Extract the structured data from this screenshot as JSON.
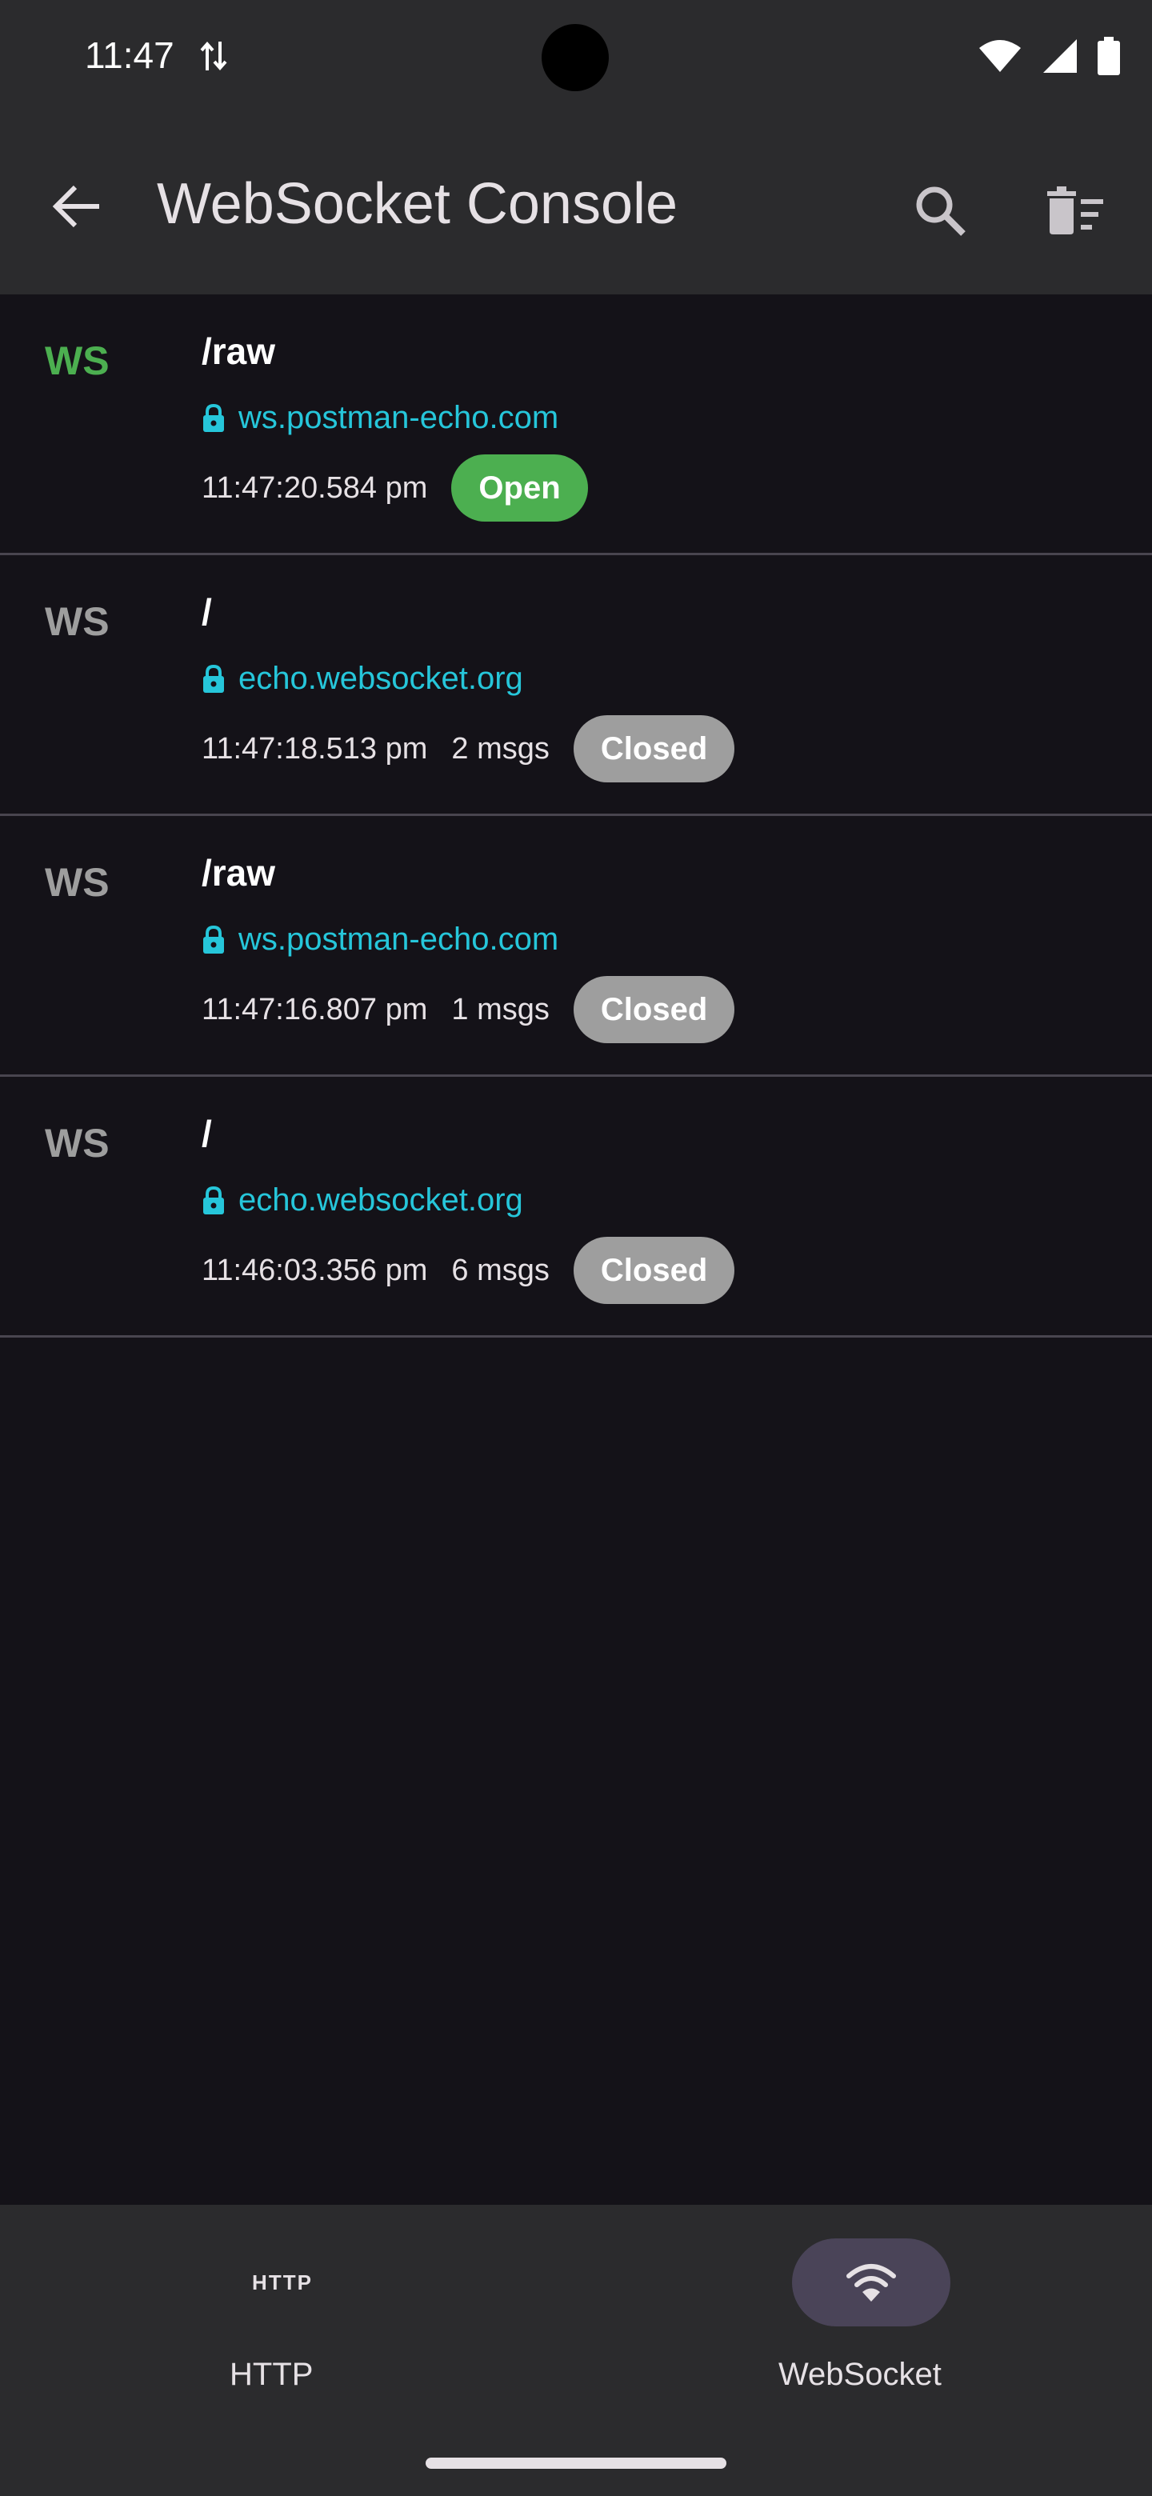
{
  "status_bar": {
    "time": "11:47"
  },
  "app_bar": {
    "title": "WebSocket Console"
  },
  "connections": [
    {
      "tag": "WS",
      "path": "/raw",
      "host": "ws.postman-echo.com",
      "time": "11:47:20.584 pm",
      "msgs": "",
      "status": "Open",
      "state": "open"
    },
    {
      "tag": "WS",
      "path": "/",
      "host": "echo.websocket.org",
      "time": "11:47:18.513 pm",
      "msgs": "2 msgs",
      "status": "Closed",
      "state": "closed"
    },
    {
      "tag": "WS",
      "path": "/raw",
      "host": "ws.postman-echo.com",
      "time": "11:47:16.807 pm",
      "msgs": "1 msgs",
      "status": "Closed",
      "state": "closed"
    },
    {
      "tag": "WS",
      "path": "/",
      "host": "echo.websocket.org",
      "time": "11:46:03.356 pm",
      "msgs": "6 msgs",
      "status": "Closed",
      "state": "closed"
    }
  ],
  "bottom_nav": {
    "http_glyph": "HTTP",
    "http_label": "HTTP",
    "ws_label": "WebSocket",
    "selected": "WebSocket"
  },
  "icons": {
    "back": "arrow-back-icon",
    "search": "search-icon",
    "clear": "delete-sweep-icon",
    "lock": "lock-icon",
    "wifi": "wifi-icon"
  },
  "colors": {
    "open_green": "#4caf50",
    "closed_gray": "#9e9e9e",
    "host_cyan": "#26c6da",
    "background": "#141218",
    "surface": "#2b2b2d"
  }
}
